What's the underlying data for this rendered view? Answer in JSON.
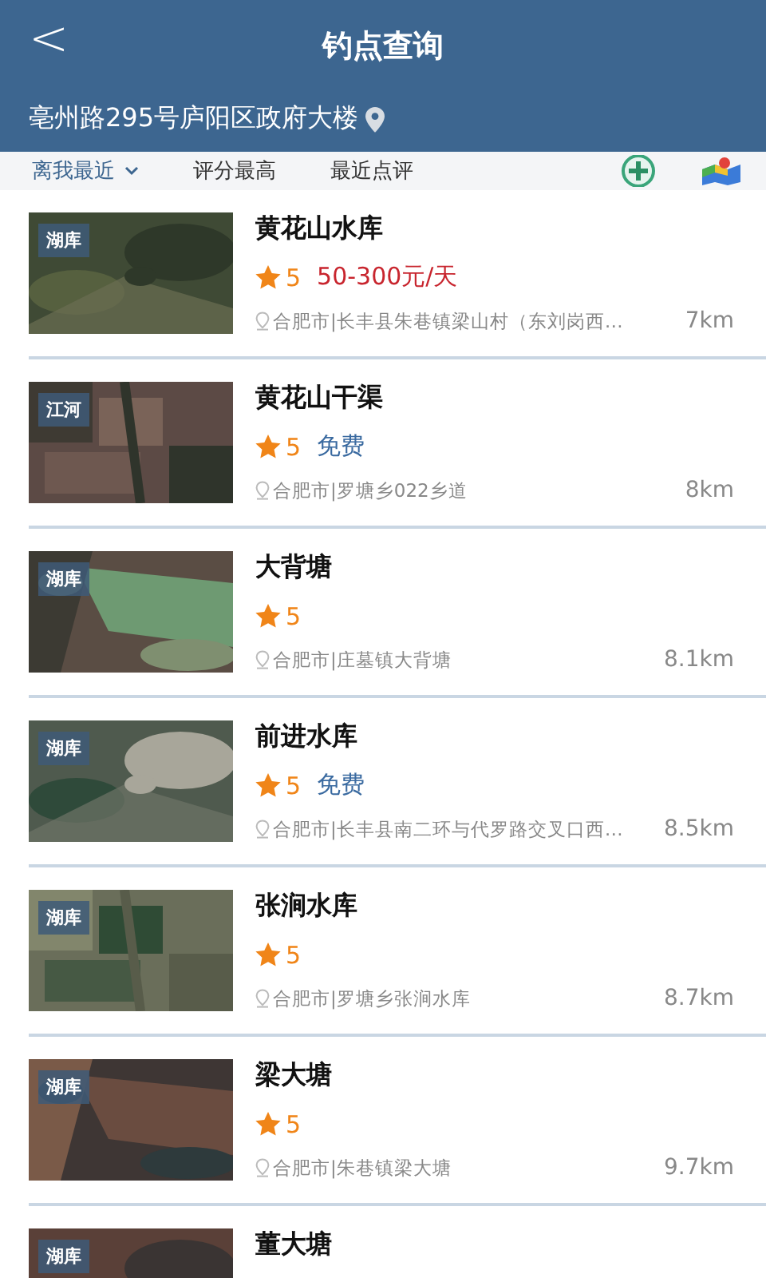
{
  "header": {
    "back": "<",
    "title": "钓点查询",
    "address": "亳州路295号庐阳区政府大楼"
  },
  "filters": [
    {
      "label": "离我最近",
      "selected": true,
      "dropdown": true
    },
    {
      "label": "评分最高",
      "selected": false,
      "dropdown": false
    },
    {
      "label": "最近点评",
      "selected": false,
      "dropdown": false
    }
  ],
  "spots": [
    {
      "tag": "湖库",
      "name": "黄花山水库",
      "rating": "5",
      "price": {
        "kind": "paid",
        "text": "50-300元/天"
      },
      "address": "合肥市|长丰县朱巷镇梁山村（东刘岗西…",
      "distance": "7km"
    },
    {
      "tag": "江河",
      "name": "黄花山干渠",
      "rating": "5",
      "price": {
        "kind": "free",
        "text": "免费"
      },
      "address": "合肥市|罗塘乡022乡道",
      "distance": "8km"
    },
    {
      "tag": "湖库",
      "name": "大背塘",
      "rating": "5",
      "address": "合肥市|庄墓镇大背塘",
      "distance": "8.1km"
    },
    {
      "tag": "湖库",
      "name": "前进水库",
      "rating": "5",
      "price": {
        "kind": "free",
        "text": "免费"
      },
      "address": "合肥市|长丰县南二环与代罗路交叉口西…",
      "distance": "8.5km"
    },
    {
      "tag": "湖库",
      "name": "张涧水库",
      "rating": "5",
      "address": "合肥市|罗塘乡张涧水库",
      "distance": "8.7km"
    },
    {
      "tag": "湖库",
      "name": "梁大塘",
      "rating": "5",
      "address": "合肥市|朱巷镇梁大塘",
      "distance": "9.7km"
    },
    {
      "tag": "湖库",
      "name": "董大塘"
    }
  ]
}
